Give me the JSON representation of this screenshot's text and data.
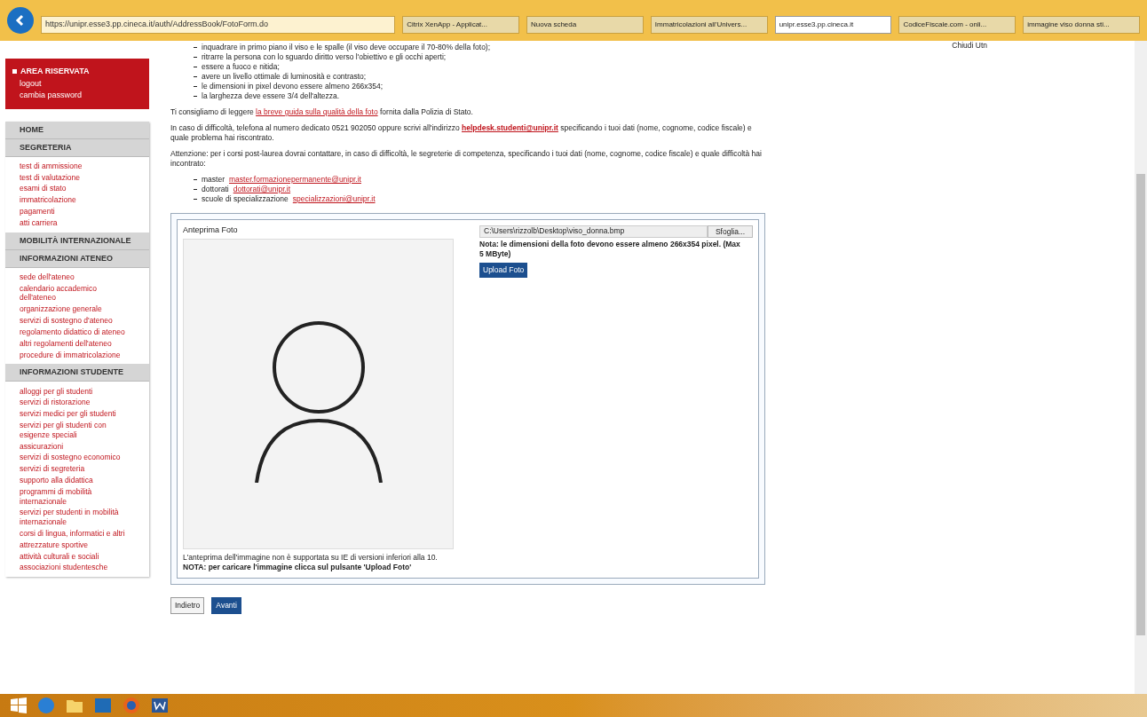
{
  "browser": {
    "url": "https://unipr.esse3.pp.cineca.it/auth/AddressBook/FotoForm.do",
    "tabs": [
      {
        "label": "Citrix XenApp - Applicat...",
        "selected": false
      },
      {
        "label": "Nuova scheda",
        "selected": false
      },
      {
        "label": "Immatricolazioni all'Univers...",
        "selected": false
      },
      {
        "label": "unipr.esse3.pp.cineca.it",
        "selected": true
      },
      {
        "label": "CodiceFiscale.com - onli...",
        "selected": false
      },
      {
        "label": "immagine viso donna sti...",
        "selected": false
      }
    ]
  },
  "top_link": "Chiudi Utn",
  "reserved_area": {
    "title": "AREA RISERVATA",
    "links": [
      "logout",
      "cambia password"
    ]
  },
  "sidebar": [
    {
      "heading": "HOME"
    },
    {
      "heading": "SEGRETERIA",
      "links": [
        "test di ammissione",
        "test di valutazione",
        "esami di stato",
        "immatricolazione",
        "pagamenti",
        "atti carriera"
      ]
    },
    {
      "heading": "MOBILITÀ INTERNAZIONALE"
    },
    {
      "heading": "INFORMAZIONI ATENEO",
      "links": [
        "sede dell'ateneo",
        "calendario accademico dell'ateneo",
        "organizzazione generale",
        "servizi di sostegno d'ateneo",
        "regolamento didattico di ateneo",
        "altri regolamenti dell'ateneo",
        "procedure di immatricolazione"
      ]
    },
    {
      "heading": "INFORMAZIONI STUDENTE",
      "links": [
        "alloggi per gli studenti",
        "servizi di ristorazione",
        "servizi medici per gli studenti",
        "servizi per gli studenti con esigenze speciali",
        "assicurazioni",
        "servizi di sostegno economico",
        "servizi di segreteria",
        "supporto alla didattica",
        "programmi di mobilità internazionale",
        "servizi per studenti in mobilità internazionale",
        "corsi di lingua, informatici e altri",
        "attrezzature sportive",
        "attività culturali e sociali",
        "associazioni studentesche"
      ]
    }
  ],
  "requirements": [
    "inquadrare in primo piano il viso e le spalle (il viso deve occupare il 70-80% della foto);",
    "ritrarre la persona con lo sguardo diritto verso l'obiettivo e gli occhi aperti;",
    "essere a fuoco e nitida;",
    "avere un livello ottimale di luminosità e contrasto;",
    "le dimensioni in pixel devono essere almeno 266x354;",
    "la larghezza deve essere 3/4 dell'altezza."
  ],
  "guide": {
    "before": "Ti consigliamo di leggere",
    "link": "la breve guida sulla qualità della foto",
    "after": "fornita dalla Polizia di Stato."
  },
  "help": {
    "before": "In caso di difficoltà, telefona al numero dedicato 0521 902050 oppure scrivi all'indirizzo",
    "link": "helpdesk.studenti@unipr.it",
    "after": "specificando i tuoi dati (nome, cognome, codice fiscale) e quale problema hai riscontrato."
  },
  "attention": "Attenzione: per i corsi post-laurea dovrai contattare, in caso di difficoltà, le segreterie di competenza, specificando i tuoi dati (nome, cognome, codice fiscale) e quale difficoltà hai incontrato:",
  "contacts": [
    {
      "label": "master",
      "email": "master.formazionepermanente@unipr.it"
    },
    {
      "label": "dottorati",
      "email": "dottorati@unipr.it"
    },
    {
      "label": "scuole di specializzazione",
      "email": "specializzazioni@unipr.it"
    }
  ],
  "upload": {
    "preview_title": "Anteprima Foto",
    "file_value": "C:\\Users\\rizzolb\\Desktop\\viso_donna.bmp",
    "browse": "Sfoglia...",
    "note": "Nota: le dimensioni della foto devono essere almeno 266x354 pixel. (Max 5 MByte)",
    "upload_button": "Upload Foto",
    "preview_note": "L'anteprima dell'immagine non è supportata su IE di versioni inferiori alla 10.",
    "hint": "NOTA: per caricare l'immagine clicca sul pulsante 'Upload Foto'"
  },
  "buttons": [
    {
      "label": "Indietro",
      "kind": "secondary"
    },
    {
      "label": "Avanti",
      "kind": "primary"
    }
  ]
}
